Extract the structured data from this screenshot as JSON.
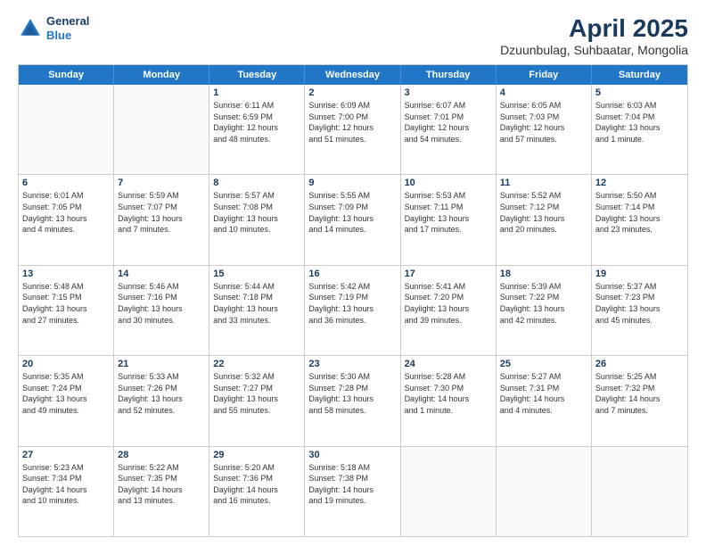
{
  "header": {
    "logo_line1": "General",
    "logo_line2": "Blue",
    "month": "April 2025",
    "location": "Dzuunbulag, Suhbaatar, Mongolia"
  },
  "weekdays": [
    "Sunday",
    "Monday",
    "Tuesday",
    "Wednesday",
    "Thursday",
    "Friday",
    "Saturday"
  ],
  "weeks": [
    [
      {
        "day": "",
        "info": ""
      },
      {
        "day": "",
        "info": ""
      },
      {
        "day": "1",
        "info": "Sunrise: 6:11 AM\nSunset: 6:59 PM\nDaylight: 12 hours\nand 48 minutes."
      },
      {
        "day": "2",
        "info": "Sunrise: 6:09 AM\nSunset: 7:00 PM\nDaylight: 12 hours\nand 51 minutes."
      },
      {
        "day": "3",
        "info": "Sunrise: 6:07 AM\nSunset: 7:01 PM\nDaylight: 12 hours\nand 54 minutes."
      },
      {
        "day": "4",
        "info": "Sunrise: 6:05 AM\nSunset: 7:03 PM\nDaylight: 12 hours\nand 57 minutes."
      },
      {
        "day": "5",
        "info": "Sunrise: 6:03 AM\nSunset: 7:04 PM\nDaylight: 13 hours\nand 1 minute."
      }
    ],
    [
      {
        "day": "6",
        "info": "Sunrise: 6:01 AM\nSunset: 7:05 PM\nDaylight: 13 hours\nand 4 minutes."
      },
      {
        "day": "7",
        "info": "Sunrise: 5:59 AM\nSunset: 7:07 PM\nDaylight: 13 hours\nand 7 minutes."
      },
      {
        "day": "8",
        "info": "Sunrise: 5:57 AM\nSunset: 7:08 PM\nDaylight: 13 hours\nand 10 minutes."
      },
      {
        "day": "9",
        "info": "Sunrise: 5:55 AM\nSunset: 7:09 PM\nDaylight: 13 hours\nand 14 minutes."
      },
      {
        "day": "10",
        "info": "Sunrise: 5:53 AM\nSunset: 7:11 PM\nDaylight: 13 hours\nand 17 minutes."
      },
      {
        "day": "11",
        "info": "Sunrise: 5:52 AM\nSunset: 7:12 PM\nDaylight: 13 hours\nand 20 minutes."
      },
      {
        "day": "12",
        "info": "Sunrise: 5:50 AM\nSunset: 7:14 PM\nDaylight: 13 hours\nand 23 minutes."
      }
    ],
    [
      {
        "day": "13",
        "info": "Sunrise: 5:48 AM\nSunset: 7:15 PM\nDaylight: 13 hours\nand 27 minutes."
      },
      {
        "day": "14",
        "info": "Sunrise: 5:46 AM\nSunset: 7:16 PM\nDaylight: 13 hours\nand 30 minutes."
      },
      {
        "day": "15",
        "info": "Sunrise: 5:44 AM\nSunset: 7:18 PM\nDaylight: 13 hours\nand 33 minutes."
      },
      {
        "day": "16",
        "info": "Sunrise: 5:42 AM\nSunset: 7:19 PM\nDaylight: 13 hours\nand 36 minutes."
      },
      {
        "day": "17",
        "info": "Sunrise: 5:41 AM\nSunset: 7:20 PM\nDaylight: 13 hours\nand 39 minutes."
      },
      {
        "day": "18",
        "info": "Sunrise: 5:39 AM\nSunset: 7:22 PM\nDaylight: 13 hours\nand 42 minutes."
      },
      {
        "day": "19",
        "info": "Sunrise: 5:37 AM\nSunset: 7:23 PM\nDaylight: 13 hours\nand 45 minutes."
      }
    ],
    [
      {
        "day": "20",
        "info": "Sunrise: 5:35 AM\nSunset: 7:24 PM\nDaylight: 13 hours\nand 49 minutes."
      },
      {
        "day": "21",
        "info": "Sunrise: 5:33 AM\nSunset: 7:26 PM\nDaylight: 13 hours\nand 52 minutes."
      },
      {
        "day": "22",
        "info": "Sunrise: 5:32 AM\nSunset: 7:27 PM\nDaylight: 13 hours\nand 55 minutes."
      },
      {
        "day": "23",
        "info": "Sunrise: 5:30 AM\nSunset: 7:28 PM\nDaylight: 13 hours\nand 58 minutes."
      },
      {
        "day": "24",
        "info": "Sunrise: 5:28 AM\nSunset: 7:30 PM\nDaylight: 14 hours\nand 1 minute."
      },
      {
        "day": "25",
        "info": "Sunrise: 5:27 AM\nSunset: 7:31 PM\nDaylight: 14 hours\nand 4 minutes."
      },
      {
        "day": "26",
        "info": "Sunrise: 5:25 AM\nSunset: 7:32 PM\nDaylight: 14 hours\nand 7 minutes."
      }
    ],
    [
      {
        "day": "27",
        "info": "Sunrise: 5:23 AM\nSunset: 7:34 PM\nDaylight: 14 hours\nand 10 minutes."
      },
      {
        "day": "28",
        "info": "Sunrise: 5:22 AM\nSunset: 7:35 PM\nDaylight: 14 hours\nand 13 minutes."
      },
      {
        "day": "29",
        "info": "Sunrise: 5:20 AM\nSunset: 7:36 PM\nDaylight: 14 hours\nand 16 minutes."
      },
      {
        "day": "30",
        "info": "Sunrise: 5:18 AM\nSunset: 7:38 PM\nDaylight: 14 hours\nand 19 minutes."
      },
      {
        "day": "",
        "info": ""
      },
      {
        "day": "",
        "info": ""
      },
      {
        "day": "",
        "info": ""
      }
    ]
  ]
}
